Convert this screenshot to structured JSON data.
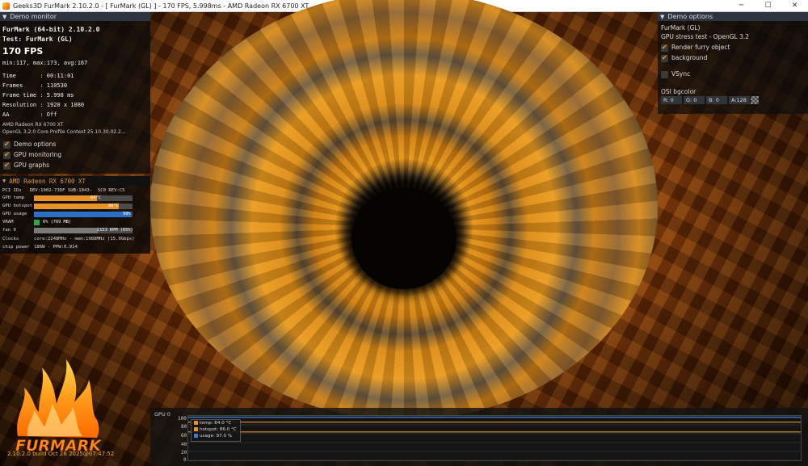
{
  "window": {
    "title": "Geeks3D FurMark 2.10.2.0 - [ FurMark (GL) ] - 170 FPS, 5.998ms - AMD Radeon RX 6700 XT",
    "controls": {
      "minimize": "─",
      "maximize": "☐",
      "close": "✕"
    }
  },
  "demo_monitor": {
    "header": "Demo monitor",
    "app": "FurMark (64-bit) 2.10.2.0",
    "test": "Test: FurMark (GL)",
    "fps": "170 FPS",
    "fps_stats": "min:117, max:173, avg:167",
    "time": "Time       : 00:11:01",
    "frames": "Frames     : 110530",
    "frame_time": "Frame time : 5.998 ms",
    "resolution": "Resolution : 1920 x 1080",
    "aa": "AA         : Off",
    "gpu_name": "AMD Radeon RX 6700 XT",
    "gl_info": "OpenGL 3.2.0 Core Profile Context 25.10.30.02.2...",
    "options": [
      {
        "label": "Demo options",
        "checked": true
      },
      {
        "label": "GPU monitoring",
        "checked": true
      },
      {
        "label": "GPU graphs",
        "checked": true
      }
    ]
  },
  "gpu_monitor": {
    "header": "AMD Radeon RX 6700 XT",
    "pci_ids": "PCI IDs   DEV:1002-73DF SUB:1043-  SC0 REV:C5",
    "temp_label": "GPU temp",
    "temp_value": "64°C",
    "temp_fraction": 0.64,
    "hotspot_label": "GPU hotspot",
    "hotspot_value": "86°C",
    "hotspot_fraction": 0.86,
    "usage_label": "GPU usage",
    "usage_value": "98%",
    "usage_fraction": 0.98,
    "vram_label": "VRAM",
    "vram_value": "6% (769 MB)",
    "vram_fraction": 0.06,
    "fan_label": "fan 0",
    "fan_value": "2153 RPM (65%)",
    "fan_fraction": 0.65,
    "clocks_label": "Clocks",
    "clocks_value": "core:2248MHz - mem:1988MHz (15.9Gbps)",
    "power_label": "chip power",
    "power_value": "186W - PPW:0.914"
  },
  "demo_options": {
    "header": "Demo options",
    "name": "FurMark (GL)",
    "desc": "GPU stress test - OpenGL 3.2",
    "render_furry": "Render furry object",
    "background": "background",
    "vsync": "VSync",
    "osi_bgcolor": "OSI bgcolor",
    "r": "R: 0",
    "g": "G: 0",
    "b": "B: 0",
    "a": "A:128"
  },
  "graph": {
    "title": "GPU 0",
    "y_ticks": [
      "100",
      "80",
      "60",
      "40",
      "20",
      "0"
    ],
    "legend": [
      {
        "label": "temp: 64.0 °C",
        "color": "#e8922a"
      },
      {
        "label": "hotspot: 86.0 °C",
        "color": "#e8922a"
      },
      {
        "label": "usage: 97.0 %",
        "color": "#3a7fd6"
      }
    ]
  },
  "chart_data": {
    "type": "line",
    "title": "GPU 0",
    "ylim": [
      0,
      100
    ],
    "y_ticks": [
      100,
      80,
      60,
      40,
      20,
      0
    ],
    "series": [
      {
        "name": "temp: 64.0 °C",
        "value": 64,
        "color": "#e8922a"
      },
      {
        "name": "hotspot: 86.0 °C",
        "value": 86,
        "color": "#e8922a"
      },
      {
        "name": "usage: 97.0 %",
        "value": 97,
        "color": "#3a7fd6"
      }
    ]
  },
  "logo": {
    "text": "FURMARK"
  },
  "build": "2.10.2.0 build Oct 26 2025@07:47:52"
}
